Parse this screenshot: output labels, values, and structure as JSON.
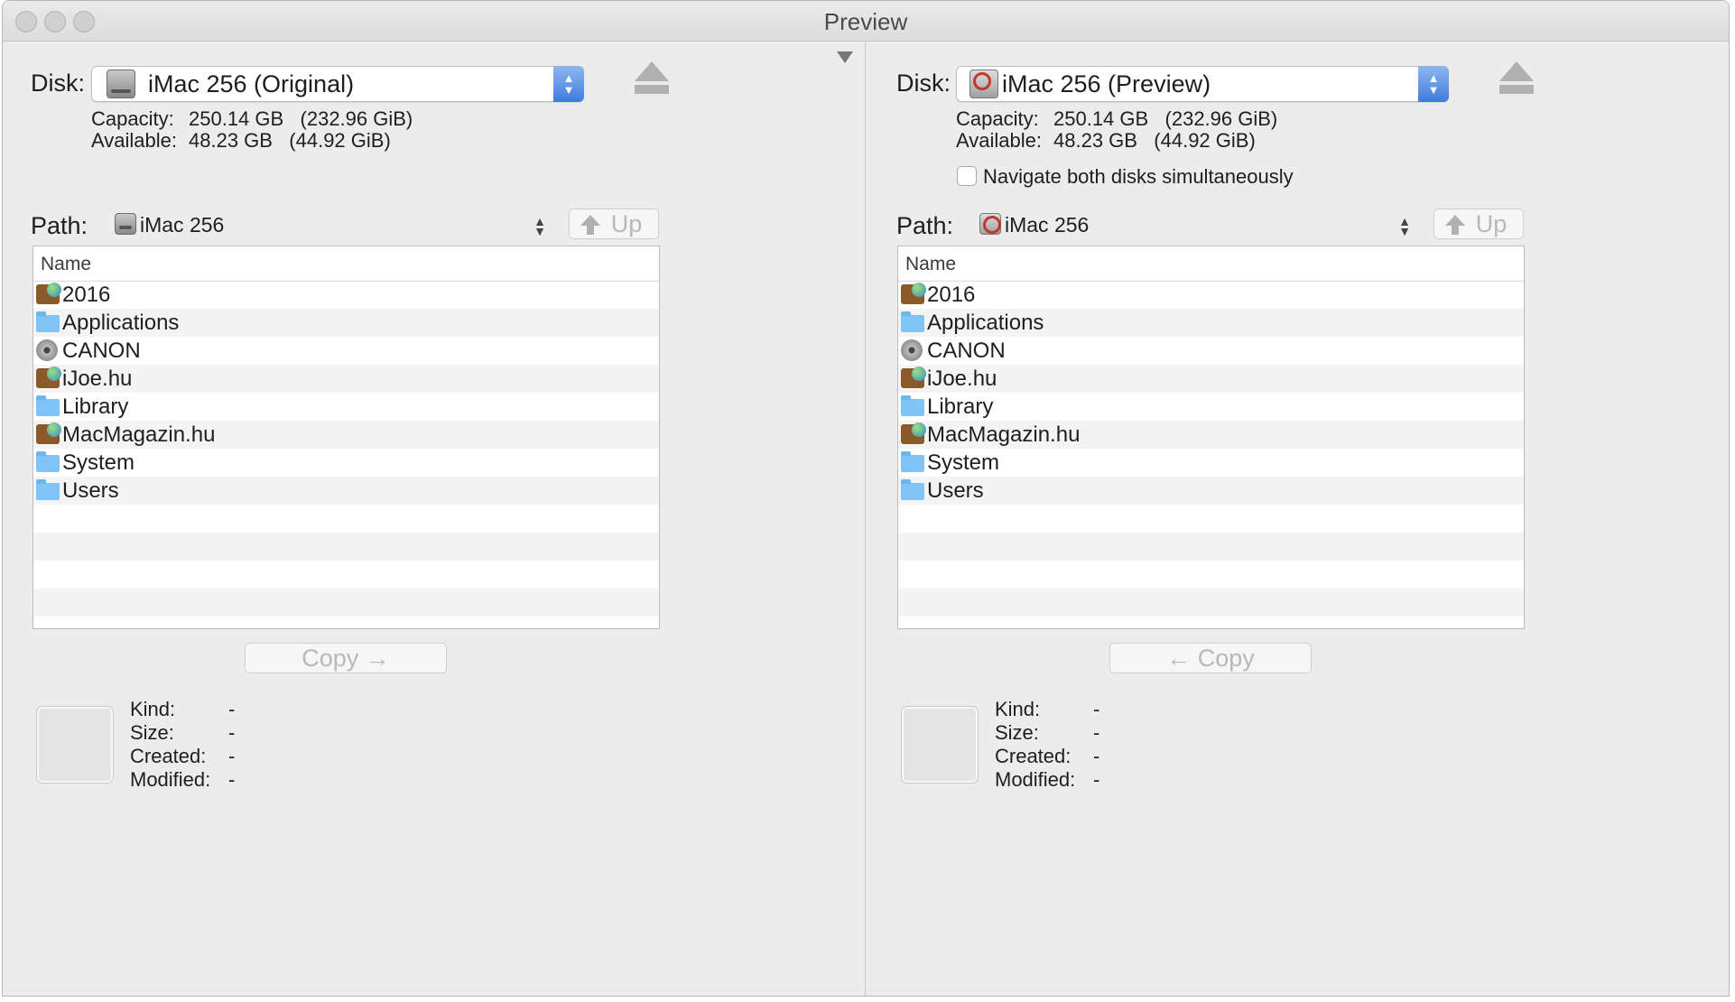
{
  "window": {
    "title": "Preview"
  },
  "left": {
    "disk_label": "Disk:",
    "disk_value": "iMac 256 (Original)",
    "disk_icon": "hard-drive-icon",
    "capacity_label": "Capacity:",
    "capacity_value": "250.14 GB   (232.96 GiB)",
    "available_label": "Available:",
    "available_value": "48.23 GB   (44.92 GiB)",
    "path_label": "Path:",
    "path_value": "iMac 256",
    "up_label": "Up",
    "column_header": "Name",
    "items": [
      {
        "name": "2016",
        "icon": "alias"
      },
      {
        "name": "Applications",
        "icon": "folder"
      },
      {
        "name": "CANON",
        "icon": "disk"
      },
      {
        "name": "iJoe.hu",
        "icon": "alias"
      },
      {
        "name": "Library",
        "icon": "folder"
      },
      {
        "name": "MacMagazin.hu",
        "icon": "alias"
      },
      {
        "name": "System",
        "icon": "folder"
      },
      {
        "name": "Users",
        "icon": "folder"
      }
    ],
    "copy_label": "Copy →",
    "kind_label": "Kind:",
    "kind_value": "-",
    "size_label": "Size:",
    "size_value": "-",
    "created_label": "Created:",
    "created_value": "-",
    "modified_label": "Modified:",
    "modified_value": "-"
  },
  "right": {
    "disk_label": "Disk:",
    "disk_value": "iMac 256 (Preview)",
    "disk_icon": "preview-disk-icon",
    "capacity_label": "Capacity:",
    "capacity_value": "250.14 GB   (232.96 GiB)",
    "available_label": "Available:",
    "available_value": "48.23 GB   (44.92 GiB)",
    "navigate_label": "Navigate both disks simultaneously",
    "navigate_checked": false,
    "path_label": "Path:",
    "path_value": "iMac 256",
    "up_label": "Up",
    "column_header": "Name",
    "items": [
      {
        "name": "2016",
        "icon": "alias"
      },
      {
        "name": "Applications",
        "icon": "folder"
      },
      {
        "name": "CANON",
        "icon": "disk"
      },
      {
        "name": "iJoe.hu",
        "icon": "alias"
      },
      {
        "name": "Library",
        "icon": "folder"
      },
      {
        "name": "MacMagazin.hu",
        "icon": "alias"
      },
      {
        "name": "System",
        "icon": "folder"
      },
      {
        "name": "Users",
        "icon": "folder"
      }
    ],
    "copy_label": "← Copy",
    "kind_label": "Kind:",
    "kind_value": "-",
    "size_label": "Size:",
    "size_value": "-",
    "created_label": "Created:",
    "created_value": "-",
    "modified_label": "Modified:",
    "modified_value": "-"
  }
}
